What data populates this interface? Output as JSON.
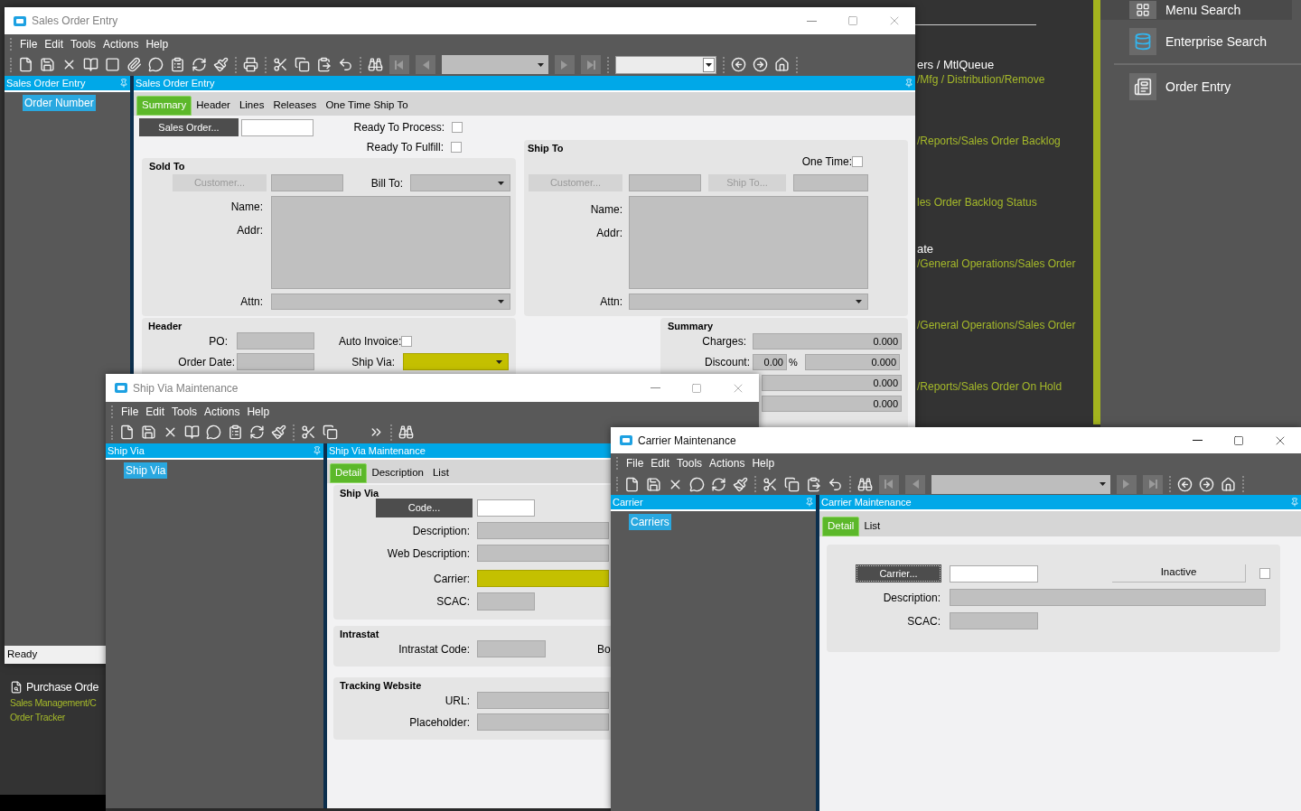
{
  "background": {
    "side_menu": [
      {
        "label": "Menu Search",
        "selected": true
      },
      {
        "label": "Enterprise Search",
        "selected": false
      },
      {
        "label": "Order Entry",
        "selected": false
      }
    ],
    "results": [
      {
        "title": "ers / MtlQueue",
        "path": "/Mfg / Distribution/Remove"
      },
      {
        "path": "/Reports/Sales Order Backlog"
      },
      {
        "path": "les Order Backlog Status"
      },
      {
        "title": "ate",
        "path": "/General Operations/Sales Order"
      },
      {
        "path": "/General Operations/Sales Order"
      },
      {
        "path": "/Reports/Sales Order On Hold"
      }
    ],
    "left_result": {
      "title": "Purchase Orde",
      "lines": [
        "Sales Management/C",
        "Order Tracker"
      ]
    }
  },
  "sales_order_window": {
    "title": "Sales Order Entry",
    "active": false,
    "menu": [
      "File",
      "Edit",
      "Tools",
      "Actions",
      "Help"
    ],
    "tree_header": "Sales Order Entry",
    "tree": [
      {
        "label": "Order Number",
        "selected": true
      }
    ],
    "status": "Ready",
    "pane_header": "Sales Order Entry",
    "tabs": [
      {
        "label": "Summary",
        "selected": true
      },
      {
        "label": "Header",
        "selected": false
      },
      {
        "label": "Lines",
        "selected": false
      },
      {
        "label": "Releases",
        "selected": false
      },
      {
        "label": "One Time Ship To",
        "selected": false
      }
    ],
    "sales_order_button": "Sales Order...",
    "ready_to_process": {
      "label": "Ready To Process:",
      "checked": false
    },
    "ready_to_fulfill": {
      "label": "Ready To Fulfill:",
      "checked": false
    },
    "sold_to": {
      "title": "Sold To",
      "customer_button": {
        "label": "Customer...",
        "disabled": true
      },
      "bill_to_label": "Bill To:",
      "name_label": "Name:",
      "addr_label": "Addr:",
      "attn_label": "Attn:"
    },
    "ship_to": {
      "title": "Ship To",
      "one_time": {
        "label": "One Time:",
        "checked": false
      },
      "customer_button": {
        "label": "Customer...",
        "disabled": true
      },
      "ship_to_button": {
        "label": "Ship To...",
        "disabled": true
      },
      "name_label": "Name:",
      "addr_label": "Addr:",
      "attn_label": "Attn:"
    },
    "header": {
      "title": "Header",
      "po_label": "PO:",
      "order_date_label": "Order Date:",
      "auto_invoice": {
        "label": "Auto Invoice:",
        "checked": false
      },
      "ship_via": {
        "label": "Ship Via:",
        "highlighted": true
      }
    },
    "summary": {
      "title": "Summary",
      "rows": [
        {
          "label": "Charges:",
          "value": "0.000"
        },
        {
          "label": "Discount:",
          "percent": "0.00",
          "percent_sign": "%",
          "value": "0.000"
        },
        {
          "value": "0.000"
        },
        {
          "value": "0.000"
        }
      ]
    }
  },
  "ship_via_window": {
    "title": "Ship Via Maintenance",
    "active": false,
    "menu": [
      "File",
      "Edit",
      "Tools",
      "Actions",
      "Help"
    ],
    "tree_header": "Ship Via",
    "tree": [
      {
        "label": "Ship Via",
        "selected": true
      }
    ],
    "pane_header": "Ship Via Maintenance",
    "tabs": [
      {
        "label": "Detail",
        "selected": true
      },
      {
        "label": "Description",
        "selected": false
      },
      {
        "label": "List",
        "selected": false
      }
    ],
    "groups": [
      {
        "title": "Ship Via",
        "fields": [
          {
            "kind": "button",
            "button": "Code..."
          },
          {
            "kind": "wide",
            "label": "Description:",
            "highlighted": false
          },
          {
            "kind": "wide",
            "label": "Web Description:",
            "highlighted": false
          },
          {
            "kind": "wide",
            "label": "Carrier:",
            "highlighted": true
          },
          {
            "kind": "short",
            "label": "SCAC:",
            "highlighted": false
          }
        ]
      },
      {
        "title": "Intrastat",
        "fields": [
          {
            "kind": "short",
            "label": "Intrastat Code:",
            "side_label": "Bo",
            "highlighted": false
          }
        ]
      },
      {
        "title": "Tracking Website",
        "fields": [
          {
            "kind": "wide",
            "label": "URL:",
            "highlighted": false
          },
          {
            "kind": "wide",
            "label": "Placeholder:",
            "highlighted": false
          }
        ]
      }
    ]
  },
  "carrier_window": {
    "title": "Carrier Maintenance",
    "active": true,
    "menu": [
      "File",
      "Edit",
      "Tools",
      "Actions",
      "Help"
    ],
    "tree_header": "Carrier",
    "tree": [
      {
        "label": "Carriers",
        "selected": true
      }
    ],
    "pane_header": "Carrier Maintenance",
    "tabs": [
      {
        "label": "Detail",
        "selected": true
      },
      {
        "label": "List",
        "selected": false
      }
    ],
    "carrier_button": "Carrier...",
    "inactive": {
      "label": "Inactive",
      "checked": false
    },
    "description_label": "Description:",
    "scac_label": "SCAC:"
  }
}
